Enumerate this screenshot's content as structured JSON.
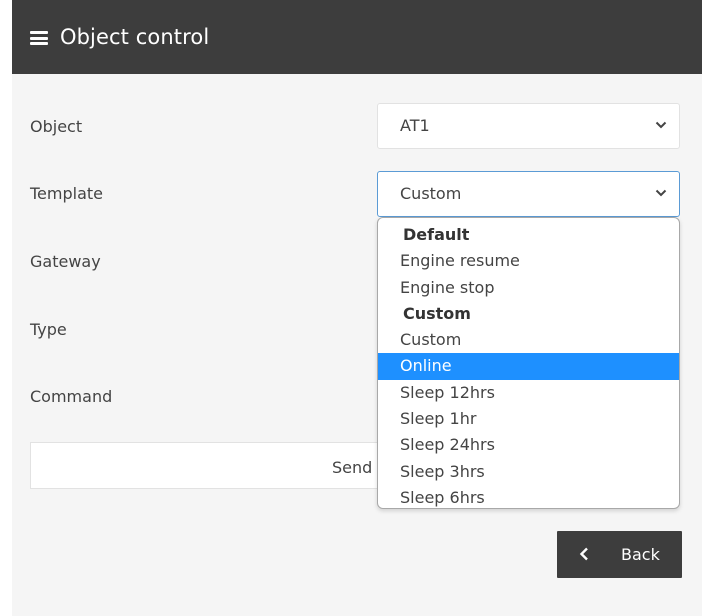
{
  "header": {
    "title": "Object control",
    "menu_icon": "hamburger-menu-icon"
  },
  "form": {
    "object": {
      "label": "Object",
      "value": "AT1"
    },
    "template": {
      "label": "Template",
      "value": "Custom"
    },
    "gateway": {
      "label": "Gateway"
    },
    "type": {
      "label": "Type"
    },
    "command": {
      "label": "Command"
    }
  },
  "send": {
    "label": "Send"
  },
  "dropdown": {
    "options": [
      {
        "text": "Default",
        "group": true
      },
      {
        "text": "Engine resume"
      },
      {
        "text": "Engine stop"
      },
      {
        "text": "Custom",
        "group": true
      },
      {
        "text": "Custom"
      },
      {
        "text": "Online",
        "selected": true
      },
      {
        "text": "Sleep 12hrs"
      },
      {
        "text": "Sleep 1hr"
      },
      {
        "text": "Sleep 24hrs"
      },
      {
        "text": "Sleep 3hrs"
      },
      {
        "text": "Sleep 6hrs"
      }
    ]
  },
  "back": {
    "label": "Back",
    "icon": "chevron-left-icon"
  },
  "colors": {
    "header": "#3d3d3d",
    "highlight": "#1e90ff",
    "focus_border": "#5b9bd5",
    "panel": "#f5f5f5"
  }
}
